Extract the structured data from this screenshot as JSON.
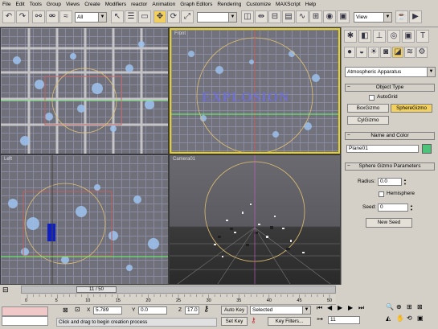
{
  "menu": [
    "File",
    "Edit",
    "Tools",
    "Group",
    "Views",
    "Create",
    "Modifiers",
    "reactor",
    "Animation",
    "Graph Editors",
    "Rendering",
    "Customize",
    "MAXScript",
    "Help"
  ],
  "toolbar": {
    "selection_filter": "All",
    "view_dropdown": "View"
  },
  "viewports": {
    "front_label": "Front",
    "left_label": "Left",
    "camera_label": "Camera01",
    "explosion_text": "EXPLOSION"
  },
  "command_panel": {
    "category": "Atmospheric Apparatus",
    "object_type_title": "Object Type",
    "autogrid": "AutoGrid",
    "box_gizmo": "BoxGizmo",
    "sphere_gizmo": "SphereGizmo",
    "cyl_gizmo": "CylGizmo",
    "name_color_title": "Name and Color",
    "object_name": "Plane01",
    "object_color": "#4cc27a",
    "params_title": "Sphere Gizmo Parameters",
    "radius_label": "Radius:",
    "radius_value": "0.0",
    "hemisphere": "Hemisphere",
    "seed_label": "Seed:",
    "seed_value": "0",
    "new_seed": "New Seed"
  },
  "timeline": {
    "frame_counter": "11 / 50",
    "ticks": [
      "0",
      "5",
      "10",
      "15",
      "20",
      "25",
      "30",
      "35",
      "40",
      "45",
      "50"
    ]
  },
  "status": {
    "x_label": "X",
    "x_value": "5.789",
    "y_label": "Y",
    "y_value": "0.0",
    "z_label": "Z",
    "z_value": "17.0",
    "prompt": "Click and drag to begin creation process",
    "auto_key": "Auto Key",
    "key_mode": "Selected",
    "set_key": "Set Key",
    "key_filters": "Key Filters...",
    "current_frame": "11"
  },
  "colors": {
    "active_button": "#f2d060",
    "viewport_bg": "#6a6a6e",
    "active_viewport_border": "#e8d020"
  }
}
